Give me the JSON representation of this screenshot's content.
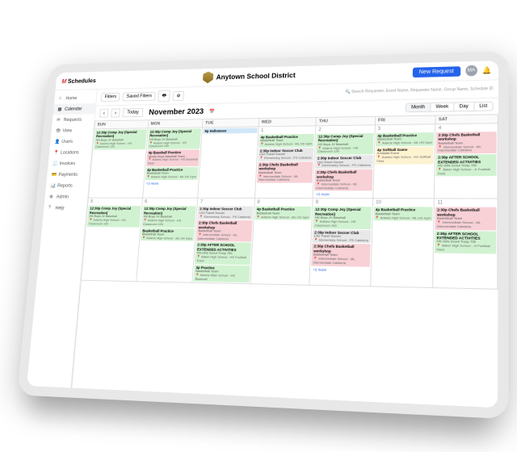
{
  "header": {
    "app_name": "Schedules",
    "district": "Anytown School District",
    "new_request": "New Request",
    "avatar": "MA"
  },
  "sidebar": {
    "items": [
      {
        "label": "Home"
      },
      {
        "label": "Calendar"
      },
      {
        "label": "Requests"
      },
      {
        "label": "View"
      },
      {
        "label": "Users"
      },
      {
        "label": "Locations"
      },
      {
        "label": "Invoices"
      },
      {
        "label": "Payments"
      },
      {
        "label": "Reports"
      },
      {
        "label": "Admin"
      },
      {
        "label": "Help"
      }
    ]
  },
  "toolbar": {
    "filters": "Filters",
    "saved_filters": "Saved Filters",
    "search_placeholder": "Search Requester, Event Name, Requester Name, Group Name, Schedule ID"
  },
  "calendar": {
    "today": "Today",
    "title": "November 2023",
    "views": [
      "Month",
      "Week",
      "Day",
      "List"
    ],
    "day_headers": [
      "SUN",
      "MON",
      "TUE",
      "WED",
      "THU",
      "FRI",
      "SAT"
    ],
    "more_prefix": "+",
    "more_suffix": " more",
    "weeks": [
      {
        "days": [
          {
            "n": "",
            "ev": [
              {
                "c": "green",
                "t": "12:30p Comp Joy (Special Recreation)",
                "s": "HS Boys JV Baseball",
                "l": "Adams High School - HS Classroom 100"
              }
            ]
          },
          {
            "n": "",
            "ev": [
              {
                "c": "green",
                "t": "12:30p Comp Joy (Special Recreation)",
                "s": "HS Boys JV Baseball",
                "l": "Adams High School - HS Classroom 100"
              },
              {
                "c": "pink",
                "t": "4p Baseball Practice",
                "s": "Varsity Boys Baseball Team",
                "l": "Adams High School - HS Baseball Field"
              },
              {
                "c": "green",
                "t": "4p Basketball Practice",
                "s": "Basketball Team",
                "l": "Adams High School - ML HS Gym"
              }
            ],
            "more": 2
          },
          {
            "n": "",
            "ev": [
              {
                "c": "blue",
                "t": "9p Halloween"
              }
            ]
          },
          {
            "n": "1",
            "ev": [
              {
                "c": "green",
                "t": "4p Basketball Practice",
                "s": "Basketball Team",
                "l": "Adams High School - ML HS Gym"
              },
              {
                "c": "gray",
                "t": "2:30p Indoor Soccer Club",
                "s": "LNJ Travel Soccer",
                "l": "Elementary School - PS Cafeteria"
              },
              {
                "c": "pink",
                "t": "2:30p Chefs Basketball workshop",
                "s": "Basketball Team",
                "l": "Intermediate School - ML Intermediate Cafeteria"
              }
            ]
          },
          {
            "n": "2",
            "ev": [
              {
                "c": "green",
                "t": "12:30p Comp Joy (Special Recreation)",
                "s": "HS Boys JV Baseball",
                "l": "Adams High School - HS Classroom 100"
              },
              {
                "c": "gray",
                "t": "2:30p Indoor Soccer Club",
                "s": "LNJ Travel Soccer",
                "l": "Elementary School - PS Cafeteria"
              },
              {
                "c": "pink",
                "t": "2:30p Chefs Basketball workshop",
                "s": "Basketball Team",
                "l": "Intermediate School - ML Intermediate Cafeteria"
              }
            ],
            "more": 2
          },
          {
            "n": "3",
            "ev": [
              {
                "c": "green",
                "t": "4p Basketball Practice",
                "s": "Basketball Team",
                "l": "Adams High School - ML HS Gym"
              },
              {
                "c": "yellow",
                "t": "4p Softball Game",
                "s": "A Middle Event",
                "l": "Adams High School - HS Softball Field"
              }
            ]
          },
          {
            "n": "4",
            "ev": [
              {
                "c": "pink",
                "t": "2:30p Chefs Basketball workshop",
                "s": "Basketball Team",
                "l": "Intermediate School - ML Intermediate Cafeteria"
              },
              {
                "c": "green",
                "t": "2:30p AFTER SCHOOL EXTENDED ACTIVITIES",
                "s": "HS Girls Scout Troop 700",
                "l": "Baker High School - Jr Football Field"
              }
            ]
          }
        ]
      },
      {
        "days": [
          {
            "n": "5",
            "ev": [
              {
                "c": "green",
                "t": "12:30p Comp Joy (Special Recreation)",
                "s": "HS Boys JV Baseball",
                "l": "Adams High School - HS Classroom 100"
              }
            ]
          },
          {
            "n": "6",
            "ev": [
              {
                "c": "green",
                "t": "12:30p Comp Joy (Special Recreation)",
                "s": "HS Boys JV Baseball",
                "l": "Adams High School - HS Classroom 100"
              },
              {
                "c": "green",
                "t": "Basketball Practice",
                "s": "Basketball Team",
                "l": "Adams High School - ML HS Gym"
              }
            ]
          },
          {
            "n": "7",
            "ev": [
              {
                "c": "gray",
                "t": "2:30p Indoor Soccer Club",
                "s": "LNJ Travel Soccer",
                "l": "Elementary School - PS Cafeteria"
              },
              {
                "c": "pink",
                "t": "2:30p Chefs Basketball workshop",
                "s": "Basketball Team",
                "l": "Intermediate School - ML Intermediate Cafeteria"
              },
              {
                "c": "green",
                "t": "2:30p AFTER SCHOOL EXTENDED ACTIVITIES",
                "s": "HS Girls Scout Troop 700",
                "l": "Baker High School - HS Football Track"
              },
              {
                "c": "green",
                "t": "3p Practice",
                "s": "Basketball Team",
                "l": "Adams Main School - HS Baseball"
              }
            ]
          },
          {
            "n": "8",
            "ev": [
              {
                "c": "green",
                "t": "4p Basketball Practice",
                "s": "Basketball Team",
                "l": "Adams High School - ML HS Gym"
              }
            ]
          },
          {
            "n": "9",
            "ev": [
              {
                "c": "green",
                "t": "12:30p Comp Joy (Special Recreation)",
                "s": "HS Boys JV Baseball",
                "l": "Adams High School - HS Classroom 100"
              },
              {
                "c": "gray",
                "t": "2:30p Indoor Soccer Club",
                "s": "LNJ Travel Soccer",
                "l": "Elementary School - PS Cafeteria"
              },
              {
                "c": "pink",
                "t": "2:30p Chefs Basketball workshop",
                "s": "Basketball Team",
                "l": "Intermediate School - ML Intermediate Cafeteria"
              }
            ],
            "more": 2
          },
          {
            "n": "10",
            "ev": [
              {
                "c": "green",
                "t": "4p Basketball Practice",
                "s": "Basketball Team",
                "l": "Adams High School - ML HS Gym"
              }
            ]
          },
          {
            "n": "11",
            "ev": [
              {
                "c": "pink",
                "t": "2:30p Chefs Basketball workshop",
                "s": "Basketball Team",
                "l": "Intermediate School - ML Intermediate Cafeteria"
              },
              {
                "c": "green",
                "t": "2:30p AFTER SCHOOL EXTENDED ACTIVITIES",
                "s": "HS Girls Scout Troop 700",
                "l": "Baker High School - Jr Football Field"
              }
            ]
          }
        ]
      }
    ]
  }
}
